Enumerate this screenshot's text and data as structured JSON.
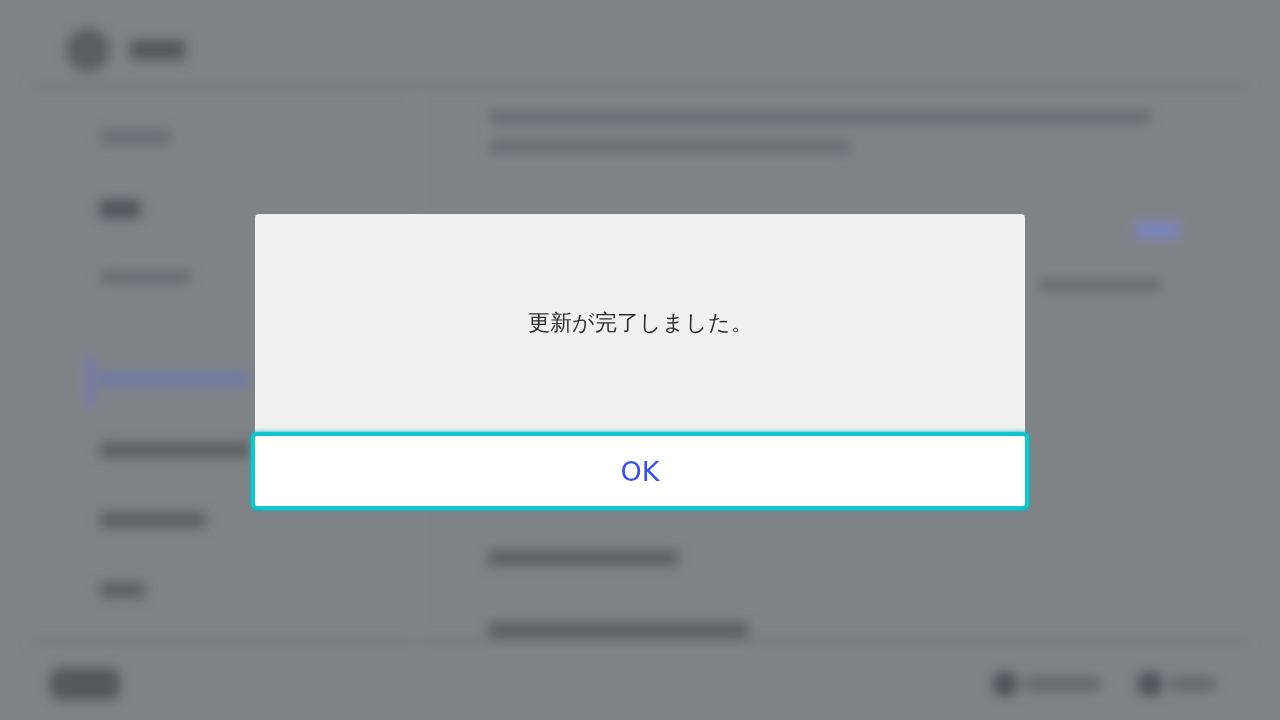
{
  "dialog": {
    "message": "更新が完了しました。",
    "buttons": [
      {
        "label": "OK",
        "focused": true
      }
    ]
  }
}
